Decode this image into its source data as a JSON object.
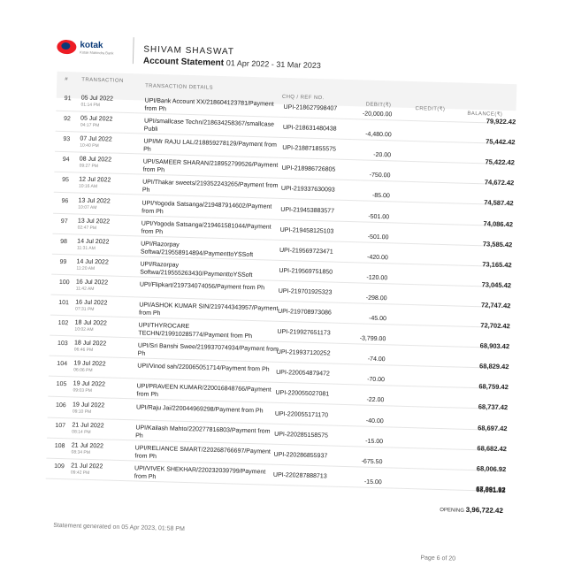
{
  "bank": {
    "name": "kotak",
    "tagline": "Kotak Mahindra Bank",
    "brand_red": "#ed1c24",
    "brand_blue": "#0a3a78",
    "logo_icon": "kotak-logo-icon"
  },
  "statement": {
    "holder": "SHIVAM SHASWAT",
    "title": "Account Statement",
    "period": "01 Apr 2022 - 31 Mar 2023"
  },
  "table": {
    "headers": {
      "no": "#",
      "date": "TRANSACTION",
      "details": "TRANSACTION DETAILS",
      "ref": "CHQ / REF NO.",
      "debit": "DEBIT(₹)",
      "credit": "CREDIT(₹)",
      "balance": "BALANCE(₹)"
    },
    "rows": [
      {
        "no": "91",
        "date": "05 Jul 2022",
        "time": "01:14 PM",
        "details": "UPI/Bank Account XX/218604123781/Payment from Ph",
        "ref": "UPI-218627998407",
        "debit": "-20,000.00",
        "balance": "79,922.42"
      },
      {
        "no": "92",
        "date": "05 Jul 2022",
        "time": "04:17 PM",
        "details": "UPI/smallcase Techn/218634258367/smallcase Publi",
        "ref": "UPI-218631480438",
        "debit": "-4,480.00",
        "balance": "75,442.42"
      },
      {
        "no": "93",
        "date": "07 Jul 2022",
        "time": "10:40 PM",
        "details": "UPI/Mr RAJU LAL/218859278129/Payment from Ph",
        "ref": "UPI-218871855575",
        "debit": "-20.00",
        "balance": "75,422.42"
      },
      {
        "no": "94",
        "date": "08 Jul 2022",
        "time": "09:27 PM",
        "details": "UPI/SAMEER SHARAN/218952799526/Payment from Ph",
        "ref": "UPI-218986726805",
        "debit": "-750.00",
        "balance": "74,672.42"
      },
      {
        "no": "95",
        "date": "12 Jul 2022",
        "time": "10:16 AM",
        "details": "UPI/Thakar sweets/219352243265/Payment from Ph",
        "ref": "UPI-219337630093",
        "debit": "-85.00",
        "balance": "74,587.42"
      },
      {
        "no": "96",
        "date": "13 Jul 2022",
        "time": "10:07 AM",
        "details": "UPI/Yogoda Satsanga/219487914602/Payment from Ph",
        "ref": "UPI-219453883577",
        "debit": "-501.00",
        "balance": "74,086.42"
      },
      {
        "no": "97",
        "date": "13 Jul 2022",
        "time": "02:47 PM",
        "details": "UPI/Yogoda Satsanga/219461581044/Payment from Ph",
        "ref": "UPI-219458125103",
        "debit": "-501.00",
        "balance": "73,585.42"
      },
      {
        "no": "98",
        "date": "14 Jul 2022",
        "time": "11:31 AM",
        "details": "UPI/Razorpay Softwa/219558914894/PaymenttoYSSoft",
        "ref": "UPI-219569723471",
        "debit": "-420.00",
        "balance": "73,165.42"
      },
      {
        "no": "99",
        "date": "14 Jul 2022",
        "time": "11:20 AM",
        "details": "UPI/Razorpay Softwa/219555263430/PaymenttoYSSoft",
        "ref": "UPI-219569751850",
        "debit": "-120.00",
        "balance": "73,045.42"
      },
      {
        "no": "100",
        "date": "16 Jul 2022",
        "time": "11:42 AM",
        "details": "UPI/Flipkart/219734074056/Payment from Ph",
        "ref": "UPI-219701925323",
        "debit": "-298.00",
        "balance": "72,747.42"
      },
      {
        "no": "101",
        "date": "16 Jul 2022",
        "time": "07:31 PM",
        "details": "UPI/ASHOK KUMAR SIN/219744343957/Payment from Ph",
        "ref": "UPI-219708973086",
        "debit": "-45.00",
        "balance": "72,702.42"
      },
      {
        "no": "102",
        "date": "18 Jul 2022",
        "time": "10:02 AM",
        "details": "UPI/THYROCARE TECHN/219910285774/Payment from Ph",
        "ref": "UPI-219927651173",
        "debit": "-3,799.00",
        "balance": "68,903.42"
      },
      {
        "no": "103",
        "date": "18 Jul 2022",
        "time": "06:46 PM",
        "details": "UPI/Sri Banshi Swee/219937074934/Payment from Ph",
        "ref": "UPI-219937120252",
        "debit": "-74.00",
        "balance": "68,829.42"
      },
      {
        "no": "104",
        "date": "19 Jul 2022",
        "time": "06:06 PM",
        "details": "UPI/Vinod sah/220065051714/Payment from Ph",
        "ref": "UPI-220054879472",
        "debit": "-70.00",
        "balance": "68,759.42"
      },
      {
        "no": "105",
        "date": "19 Jul 2022",
        "time": "09:03 PM",
        "details": "UPI/PRAVEEN KUMAR/220016848766/Payment from Ph",
        "ref": "UPI-220055027081",
        "debit": "-22.00",
        "balance": "68,737.42"
      },
      {
        "no": "106",
        "date": "19 Jul 2022",
        "time": "09:10 PM",
        "details": "UPI/Raju Jai/220044969298/Payment from Ph",
        "ref": "UPI-220055171170",
        "debit": "-40.00",
        "balance": "68,697.42"
      },
      {
        "no": "107",
        "date": "21 Jul 2022",
        "time": "08:14 PM",
        "details": "UPI/Kailash Mahto/220277816803/Payment from Ph",
        "ref": "UPI-220285158575",
        "debit": "-15.00",
        "balance": "68,682.42"
      },
      {
        "no": "108",
        "date": "21 Jul 2022",
        "time": "08:34 PM",
        "details": "UPI/RELIANCE SMART/220268766697/Payment from Ph",
        "ref": "UPI-220286855937",
        "debit": "-675.50",
        "balance": "68,006.92"
      },
      {
        "no": "109",
        "date": "21 Jul 2022",
        "time": "09:42 PM",
        "details": "UPI/VIVEK SHEKHAR/220232039799/Payment from Ph",
        "ref": "UPI-220287888713",
        "debit": "-15.00",
        "balance": "67,991.92"
      }
    ],
    "final_balance": "68,051.92"
  },
  "opening": {
    "label": "OPENING",
    "value": "3,96,722.42"
  },
  "footer": {
    "generated": "Statement generated on 05 Apr 2023, 01:58 PM",
    "page": "Page 6 of 20"
  }
}
